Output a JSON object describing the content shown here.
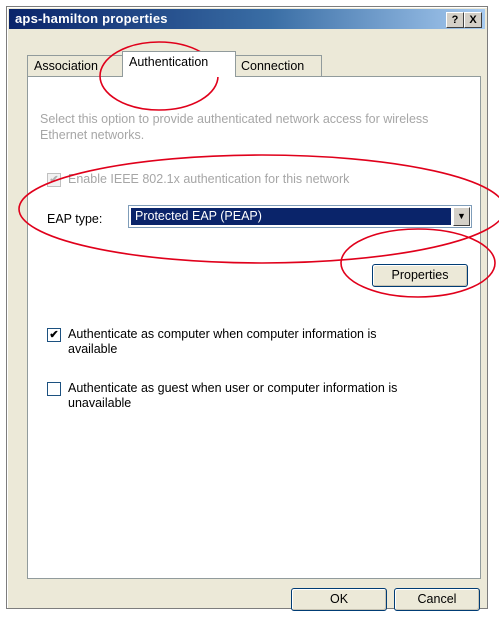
{
  "window": {
    "title": "aps-hamilton properties",
    "help_label": "?",
    "close_label": "X"
  },
  "tabs": [
    {
      "label": "Association",
      "selected": false
    },
    {
      "label": "Authentication",
      "selected": true
    },
    {
      "label": "Connection",
      "selected": false
    }
  ],
  "auth": {
    "description": "Select this option to provide authenticated network access for wireless Ethernet networks.",
    "enable_8021x": {
      "label": "Enable IEEE 802.1x authentication for this network",
      "checked": true,
      "enabled": false
    },
    "eap_type_label": "EAP type:",
    "eap_type_value": "Protected EAP (PEAP)",
    "properties_button": "Properties",
    "auth_as_computer": {
      "label": "Authenticate as computer when computer information is available",
      "checked": true
    },
    "auth_as_guest": {
      "label": "Authenticate as guest when user or computer information is unavailable",
      "checked": false
    }
  },
  "footer": {
    "ok_label": "OK",
    "cancel_label": "Cancel"
  },
  "colors": {
    "annotation": "#e0001b",
    "title_bar": "#0a246a",
    "selection": "#0a246a"
  },
  "icons": {
    "checkmark": "check-icon",
    "dropdown": "chevron-down-icon"
  }
}
